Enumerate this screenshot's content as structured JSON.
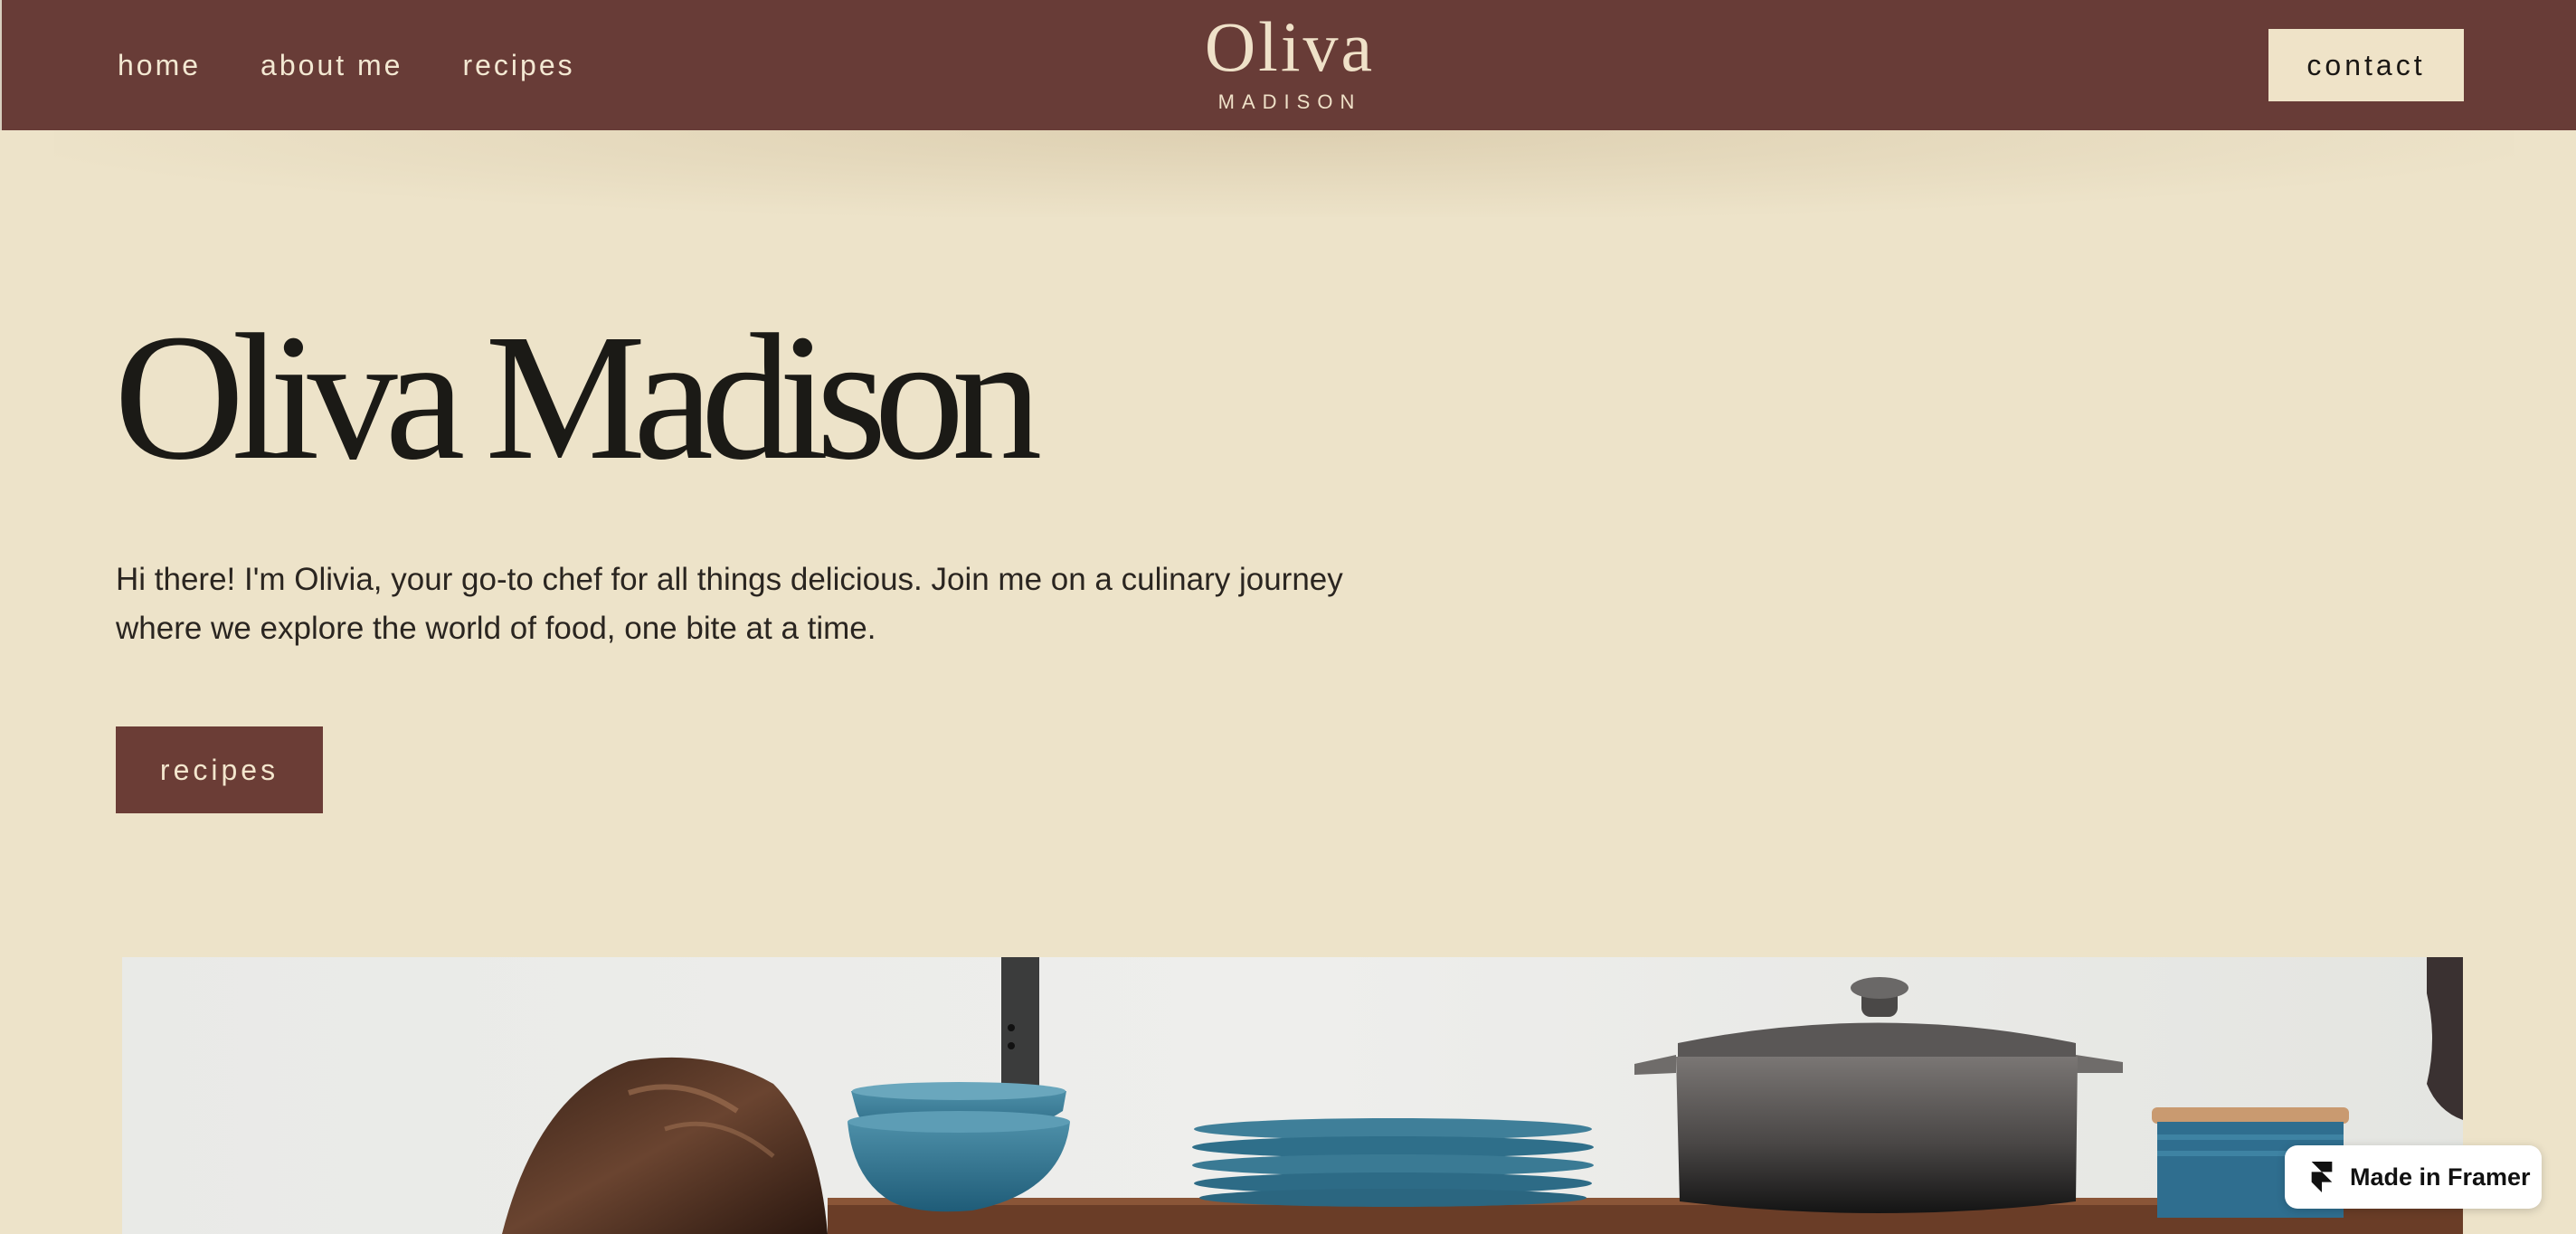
{
  "colors": {
    "header_bg": "#683c37",
    "page_bg": "#ede3c9",
    "button_bg": "#6b3d36",
    "contact_bg": "#efe3c8",
    "text_dark": "#1b1a16"
  },
  "nav": {
    "items": [
      {
        "label": "home"
      },
      {
        "label": "about me"
      },
      {
        "label": "recipes"
      }
    ]
  },
  "logo": {
    "main": "Oliva",
    "sub": "MADISON"
  },
  "header": {
    "contact_label": "contact"
  },
  "hero": {
    "title": "Oliva Madison",
    "text": "Hi there! I'm Olivia, your go-to chef for all things delicious. Join me on a culinary journey where we explore the world of food, one bite at a time.",
    "button_label": "recipes"
  },
  "image": {
    "subject": "kitchen shelf with blue bowls, plates, cast iron pot and a woman"
  },
  "badge": {
    "label": "Made in Framer",
    "icon": "framer-logo-icon"
  }
}
